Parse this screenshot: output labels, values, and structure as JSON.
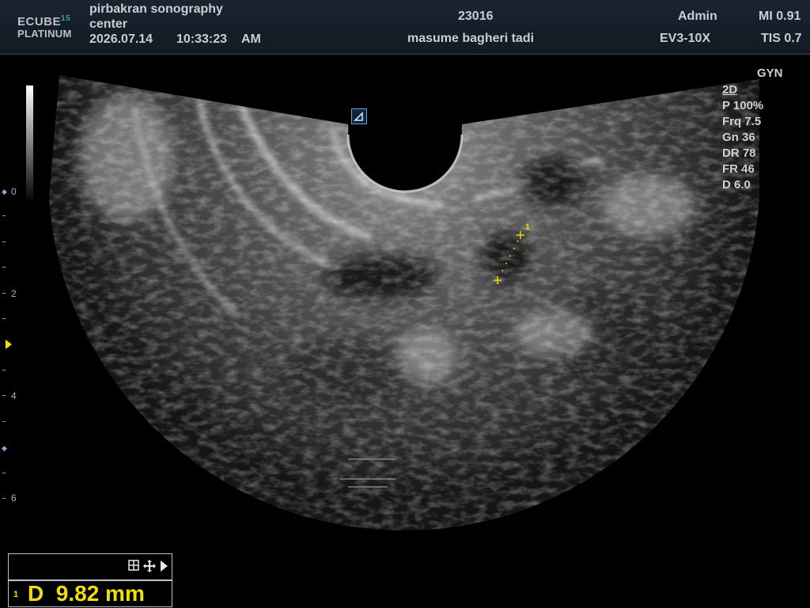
{
  "header": {
    "logo_line1": "ECUBE",
    "logo_num": "15",
    "logo_line2": "PLATINUM",
    "institution_line1": "pirbakran sonography",
    "institution_line2": "center",
    "date": "2026.07.14",
    "time": "10:33:23",
    "ampm": "AM",
    "patient_id": "23016",
    "patient_name": "masume bagheri tadi",
    "user": "Admin",
    "probe": "EV3-10X",
    "mi": "MI 0.91",
    "tis": "TIS 0.7"
  },
  "preset": "GYN",
  "params": {
    "mode": "2D",
    "power": "P 100%",
    "frequency": "Frq 7.5",
    "gain": "Gn 36",
    "dynamic_range": "DR 78",
    "frame_rate": "FR 46",
    "depth": "D 6.0"
  },
  "depth_scale": {
    "labels": [
      "0",
      "2",
      "4",
      "6"
    ]
  },
  "measurement": {
    "index": "1",
    "text": "D  9.82 mm",
    "caliper_label": "1"
  },
  "icons": {
    "probe_orientation": "probe-orientation-icon",
    "grid": "grid-icon",
    "move": "move-icon",
    "play": "play-icon"
  },
  "colors": {
    "measurement": "#f0e000",
    "header_bg": "#1a2430",
    "scale_marker": "#8aa6d8"
  }
}
